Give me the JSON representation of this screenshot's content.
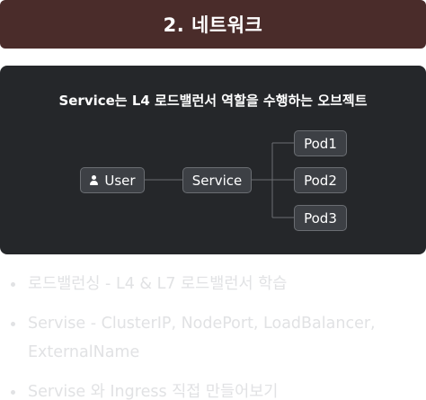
{
  "header": {
    "title": "2. 네트워크"
  },
  "diagram": {
    "title": "Service는 L4 로드밸런서 역할을 수행하는 오브젝트",
    "user_label": "User",
    "user_icon": "person-icon",
    "service_label": "Service",
    "pods": [
      "Pod1",
      "Pod2",
      "Pod3"
    ],
    "colors": {
      "panel": "#25272a",
      "node": "#3d4045",
      "node_border": "#6a6d72",
      "line": "#6a6d72"
    }
  },
  "topics": [
    "로드밸런싱 - L4 & L7 로드밸런서 학습",
    "Servise - ClusterIP, NodePort, LoadBalancer, ExternalName",
    "Servise 와 Ingress 직접 만들어보기"
  ],
  "colors": {
    "header": "#4a2c2a",
    "muted_text": "#e1e2e4"
  }
}
